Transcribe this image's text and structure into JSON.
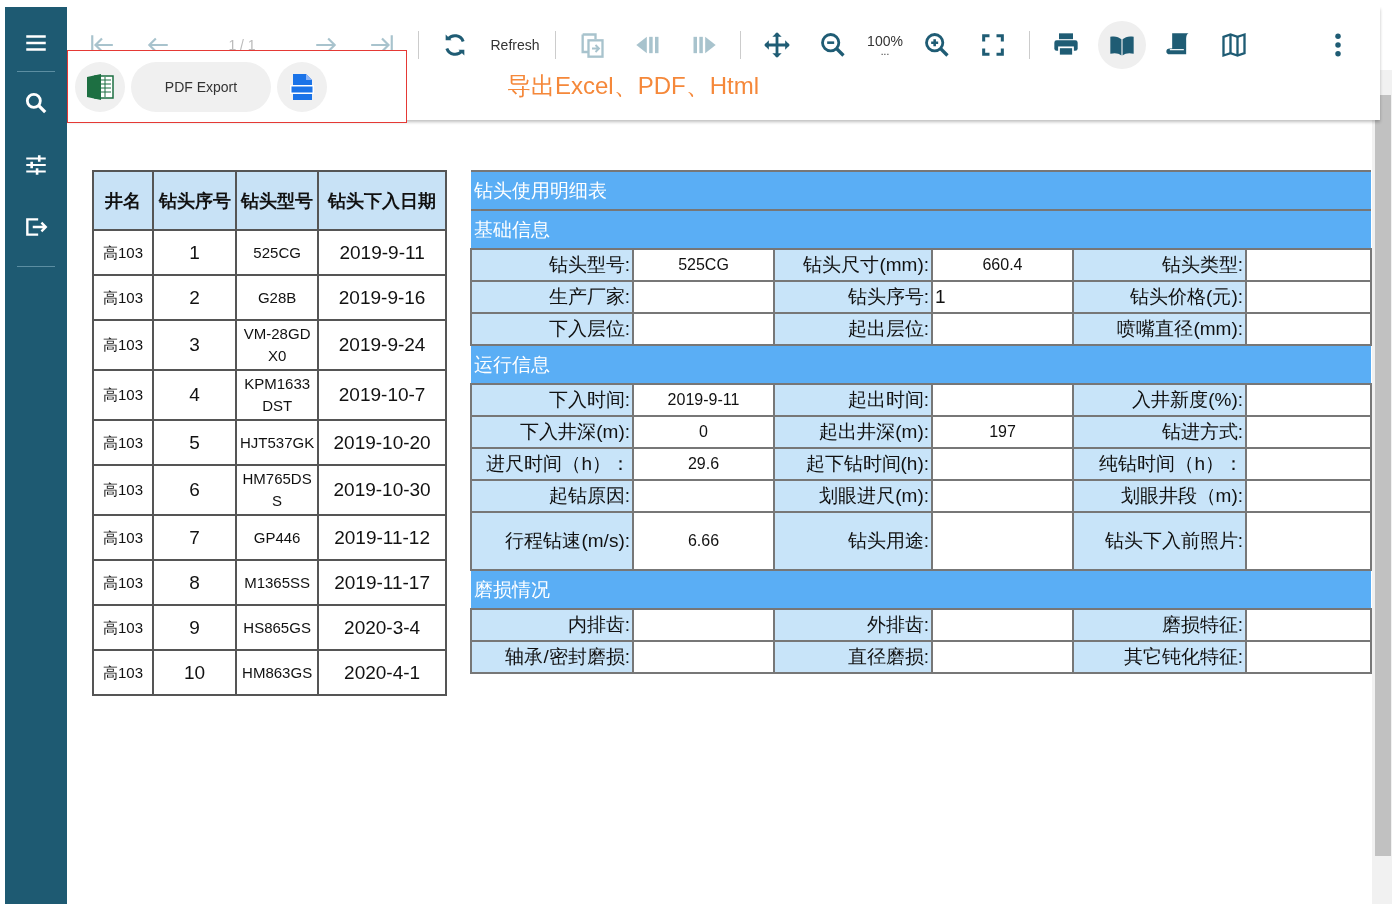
{
  "sidebar": {
    "items": [
      {
        "kind": "menu",
        "selected": false
      },
      {
        "kind": "search",
        "selected": false
      },
      {
        "kind": "parameters",
        "selected": false
      },
      {
        "kind": "export",
        "selected": false
      }
    ]
  },
  "toolbar": {
    "groups": [
      [
        {
          "kind": "first-page",
          "disabled": true,
          "selected": false
        },
        {
          "kind": "prev-page",
          "disabled": true,
          "selected": false
        },
        {
          "kind": "page-label",
          "text": "1 / 1",
          "disabled": true,
          "selected": false
        },
        {
          "kind": "next-page",
          "disabled": true,
          "selected": false
        },
        {
          "kind": "last-page",
          "disabled": true,
          "selected": false
        }
      ],
      [
        {
          "kind": "refresh",
          "disabled": false,
          "selected": false
        },
        {
          "kind": "refresh-label",
          "text": "Refresh",
          "disabled": false,
          "selected": false
        }
      ],
      [
        {
          "kind": "parent-report",
          "disabled": true,
          "selected": false
        },
        {
          "kind": "prev-section",
          "disabled": true,
          "selected": false
        },
        {
          "kind": "next-section",
          "disabled": true,
          "selected": false
        }
      ],
      [
        {
          "kind": "pan",
          "disabled": false,
          "selected": false
        },
        {
          "kind": "zoom-out",
          "disabled": false,
          "selected": false
        },
        {
          "kind": "zoom-value",
          "text": "100%",
          "hint": "...",
          "disabled": false,
          "selected": false
        },
        {
          "kind": "zoom-in",
          "disabled": false,
          "selected": false
        },
        {
          "kind": "fullscreen",
          "disabled": false,
          "selected": false
        }
      ],
      [
        {
          "kind": "print",
          "disabled": false,
          "selected": false
        },
        {
          "kind": "book",
          "disabled": false,
          "selected": true
        },
        {
          "kind": "scroll",
          "disabled": false,
          "selected": false
        },
        {
          "kind": "map",
          "disabled": false,
          "selected": false
        }
      ]
    ],
    "more": {
      "kind": "more"
    }
  },
  "export_panel": {
    "buttons": [
      {
        "kind": "excel"
      },
      {
        "kind": "pdf",
        "label": "PDF Export"
      },
      {
        "kind": "html"
      }
    ]
  },
  "annotation": "导出Excel、PDF、Html",
  "bit_list": {
    "columns": [
      "井名",
      "钻头序号",
      "钻头型号",
      "钻头下入日期"
    ],
    "rows": [
      [
        "高103",
        "1",
        "525CG",
        "2019-9-11"
      ],
      [
        "高103",
        "2",
        "G28B",
        "2019-9-16"
      ],
      [
        "高103",
        "3",
        "VM-28GDX0",
        "2019-9-24"
      ],
      [
        "高103",
        "4",
        "KPM1633DST",
        "2019-10-7"
      ],
      [
        "高103",
        "5",
        "HJT537GK",
        "2019-10-20"
      ],
      [
        "高103",
        "6",
        "HM765DSS",
        "2019-10-30"
      ],
      [
        "高103",
        "7",
        "GP446",
        "2019-11-12"
      ],
      [
        "高103",
        "8",
        "M1365SS",
        "2019-11-17"
      ],
      [
        "高103",
        "9",
        "HS865GS",
        "2020-3-4"
      ],
      [
        "高103",
        "10",
        "HM863GS",
        "2020-4-1"
      ]
    ]
  },
  "detail": {
    "title": "钻头使用明细表",
    "sections": [
      {
        "title": "基础信息",
        "rows": [
          [
            {
              "kind": "text",
              "label": "钻头型号:",
              "value": "525CG"
            },
            {
              "kind": "text",
              "label": "钻头尺寸(mm):",
              "value": "660.4"
            },
            {
              "kind": "text",
              "label": "钻头类型:"
            }
          ],
          [
            {
              "kind": "text",
              "label": "生产厂家:"
            },
            {
              "kind": "left",
              "label": "钻头序号:",
              "value": "1"
            },
            {
              "kind": "text",
              "label": "钻头价格(元):"
            }
          ],
          [
            {
              "kind": "text",
              "label": "下入层位:"
            },
            {
              "kind": "text",
              "label": "起出层位:"
            },
            {
              "kind": "text",
              "label": "喷嘴直径(mm):"
            }
          ]
        ]
      },
      {
        "title": "运行信息",
        "rows": [
          [
            {
              "kind": "text",
              "label": "下入时间:",
              "value": "2019-9-11"
            },
            {
              "kind": "text",
              "label": "起出时间:"
            },
            {
              "kind": "text",
              "label": "入井新度(%):"
            }
          ],
          [
            {
              "kind": "text",
              "label": "下入井深(m):",
              "value": "0"
            },
            {
              "kind": "text",
              "label": "起出井深(m):",
              "value": "197"
            },
            {
              "kind": "text",
              "label": "钻进方式:"
            }
          ],
          [
            {
              "kind": "text",
              "label": "进尺时间（h）：",
              "value": "29.6"
            },
            {
              "kind": "text",
              "label": "起下钻时间(h):"
            },
            {
              "kind": "text",
              "label": "纯钻时间（h）："
            }
          ],
          [
            {
              "kind": "text",
              "label": "起钻原因:"
            },
            {
              "kind": "text",
              "label": "划眼进尺(m):"
            },
            {
              "kind": "text",
              "label": "划眼井段（m):"
            }
          ],
          [
            {
              "kind": "text",
              "label": "行程钻速(m/s):",
              "value": "6.66"
            },
            {
              "kind": "text",
              "label": "钻头用途:"
            },
            {
              "kind": "image",
              "label": "钻头下入前照片:"
            }
          ]
        ]
      },
      {
        "title": "磨损情况",
        "rows": [
          [
            {
              "kind": "text",
              "label": "内排齿:"
            },
            {
              "kind": "text",
              "label": "外排齿:"
            },
            {
              "kind": "text",
              "label": "磨损特征:"
            }
          ],
          [
            {
              "kind": "text",
              "label": "轴承/密封磨损:"
            },
            {
              "kind": "text",
              "label": "直径磨损:"
            },
            {
              "kind": "text",
              "label": "其它钝化特征:"
            }
          ]
        ]
      }
    ]
  }
}
